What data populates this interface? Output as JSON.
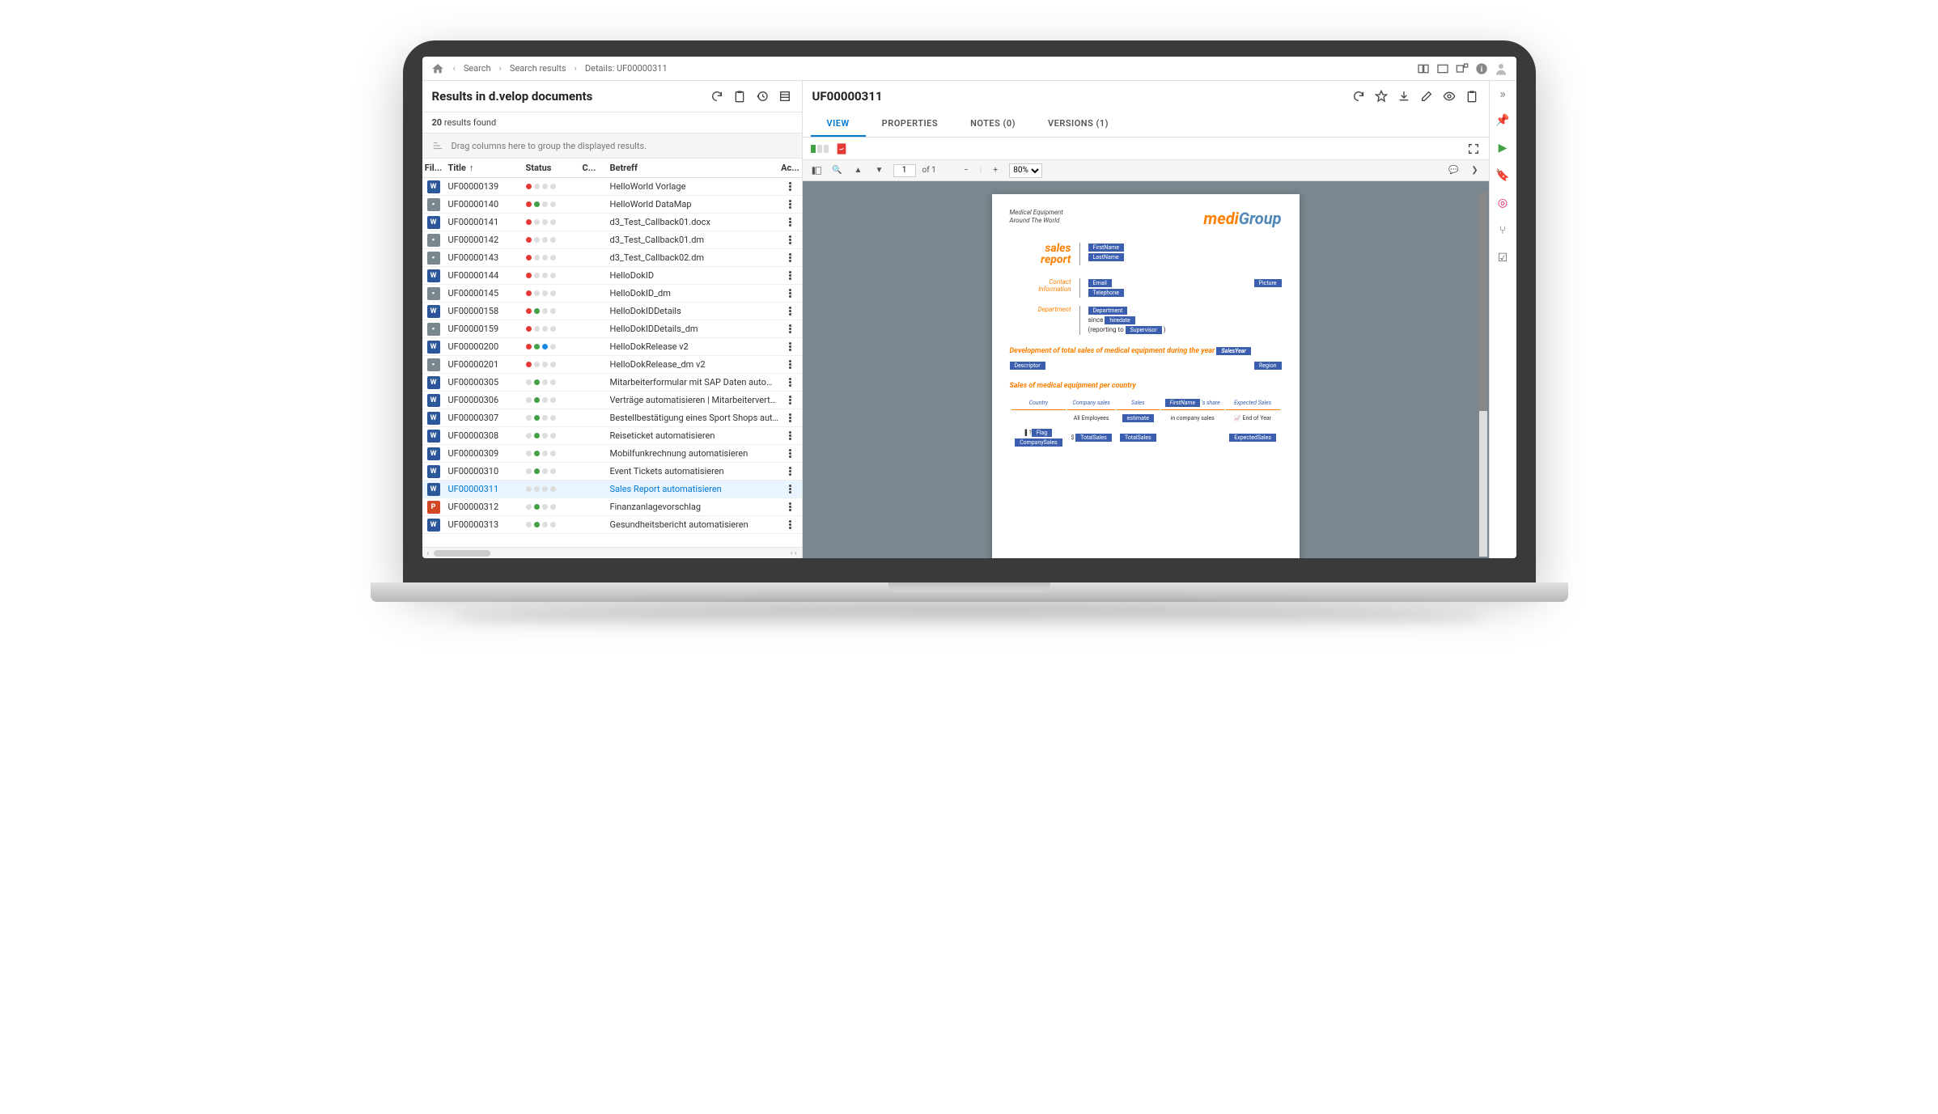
{
  "breadcrumbs": {
    "home": "",
    "back": "‹",
    "search": "Search",
    "results": "Search results",
    "details": "Details: UF00000311"
  },
  "left": {
    "title": "Results in d.velop documents",
    "count_num": "20",
    "count_text": "results found",
    "group_hint": "Drag columns here to group the displayed results.",
    "cols": {
      "file": "Fil...",
      "title": "Title",
      "status": "Status",
      "c": "C...",
      "betreff": "Betreff",
      "act": "Ac..."
    }
  },
  "rows": [
    {
      "icon": "w",
      "id": "UF00000139",
      "dots": [
        "r",
        "",
        "",
        ""
      ],
      "bet": "HelloWorld Vorlage"
    },
    {
      "icon": "g",
      "id": "UF00000140",
      "dots": [
        "r",
        "g",
        "",
        ""
      ],
      "bet": "HelloWorld DataMap"
    },
    {
      "icon": "w",
      "id": "UF00000141",
      "dots": [
        "r",
        "",
        "",
        ""
      ],
      "bet": "d3_Test_Callback01.docx"
    },
    {
      "icon": "g",
      "id": "UF00000142",
      "dots": [
        "r",
        "",
        "",
        ""
      ],
      "bet": "d3_Test_Callback01.dm"
    },
    {
      "icon": "g",
      "id": "UF00000143",
      "dots": [
        "r",
        "",
        "",
        ""
      ],
      "bet": "d3_Test_Callback02.dm"
    },
    {
      "icon": "w",
      "id": "UF00000144",
      "dots": [
        "r",
        "",
        "",
        ""
      ],
      "bet": "HelloDokID"
    },
    {
      "icon": "g",
      "id": "UF00000145",
      "dots": [
        "r",
        "",
        "",
        ""
      ],
      "bet": "HelloDokID_dm"
    },
    {
      "icon": "w",
      "id": "UF00000158",
      "dots": [
        "r",
        "g",
        "",
        ""
      ],
      "bet": "HelloDokIDDetails"
    },
    {
      "icon": "g",
      "id": "UF00000159",
      "dots": [
        "r",
        "",
        "",
        ""
      ],
      "bet": "HelloDokIDDetails_dm"
    },
    {
      "icon": "w",
      "id": "UF00000200",
      "dots": [
        "r",
        "g",
        "b",
        ""
      ],
      "bet": "HelloDokRelease v2"
    },
    {
      "icon": "g",
      "id": "UF00000201",
      "dots": [
        "r",
        "",
        "",
        ""
      ],
      "bet": "HelloDokRelease_dm v2"
    },
    {
      "icon": "w",
      "id": "UF00000305",
      "dots": [
        "",
        "g",
        "",
        ""
      ],
      "bet": "Mitarbeiterformular mit SAP Daten automatisi"
    },
    {
      "icon": "w",
      "id": "UF00000306",
      "dots": [
        "",
        "g",
        "",
        ""
      ],
      "bet": "Verträge automatisieren | Mitarbeitervertrag"
    },
    {
      "icon": "w",
      "id": "UF00000307",
      "dots": [
        "",
        "g",
        "",
        ""
      ],
      "bet": "Bestellbestätigung eines Sport Shops autom"
    },
    {
      "icon": "w",
      "id": "UF00000308",
      "dots": [
        "",
        "g",
        "",
        ""
      ],
      "bet": "Reiseticket automatisieren"
    },
    {
      "icon": "w",
      "id": "UF00000309",
      "dots": [
        "",
        "g",
        "",
        ""
      ],
      "bet": "Mobilfunkrechnung automatisieren"
    },
    {
      "icon": "w",
      "id": "UF00000310",
      "dots": [
        "",
        "g",
        "",
        ""
      ],
      "bet": "Event Tickets automatisieren"
    },
    {
      "icon": "w",
      "id": "UF00000311",
      "dots": [
        "",
        "",
        "",
        ""
      ],
      "bet": "Sales Report automatisieren",
      "sel": true
    },
    {
      "icon": "p",
      "id": "UF00000312",
      "dots": [
        "",
        "g",
        "",
        ""
      ],
      "bet": "Finanzanlagevorschlag"
    },
    {
      "icon": "w",
      "id": "UF00000313",
      "dots": [
        "",
        "g",
        "",
        ""
      ],
      "bet": "Gesundheitsbericht automatisieren"
    }
  ],
  "doc": {
    "id": "UF00000311",
    "tabs": {
      "view": "VIEW",
      "props": "PROPERTIES",
      "notes": "NOTES (0)",
      "versions": "VERSIONS (1)"
    },
    "pv": {
      "page": "1",
      "of_label": "of 1",
      "zoom": "80%"
    },
    "sub1": "Medical Equipment",
    "sub2": "Around The World",
    "logo_medi": "medi",
    "logo_group": "Group",
    "sr1": "sales",
    "sr2": "report",
    "tag_fn": "FirstName",
    "tag_ln": "LastName",
    "contact": "Contact",
    "information": "Information",
    "tag_email": "Email",
    "tag_tel": "Telephone",
    "tag_pic": "Picture",
    "dept": "Department",
    "dept_tag": "Department",
    "since": "since",
    "since_tag": "hiredate",
    "reporting": "(reporting to",
    "rep_tag": "Supervisor",
    "close": ")",
    "sec1": "Development of total sales of medical equipment during the year",
    "sec1_tag": "SalesYear",
    "sec1_tag2": "Descriptor",
    "sec1_tag3": "Region",
    "sec2": "Sales of medical equipment per country",
    "th1": "Country",
    "th2": "Company sales",
    "th3": "Sales",
    "th4": "'s share",
    "th5": "Expected Sales",
    "th4_tag": "FirstName",
    "tr2a": "All Employees",
    "tr2b": "estimate",
    "tr2c": "in company sales",
    "tr2d": "End of Year",
    "cell_flag": "Flag",
    "cell_comp": "CompanySales",
    "cell_sales": "TotalSales",
    "cell_share": "TotalSales",
    "cell_exp": "ExpectedSales",
    "cell_dollar": "$"
  },
  "drawer_collapse": "»"
}
